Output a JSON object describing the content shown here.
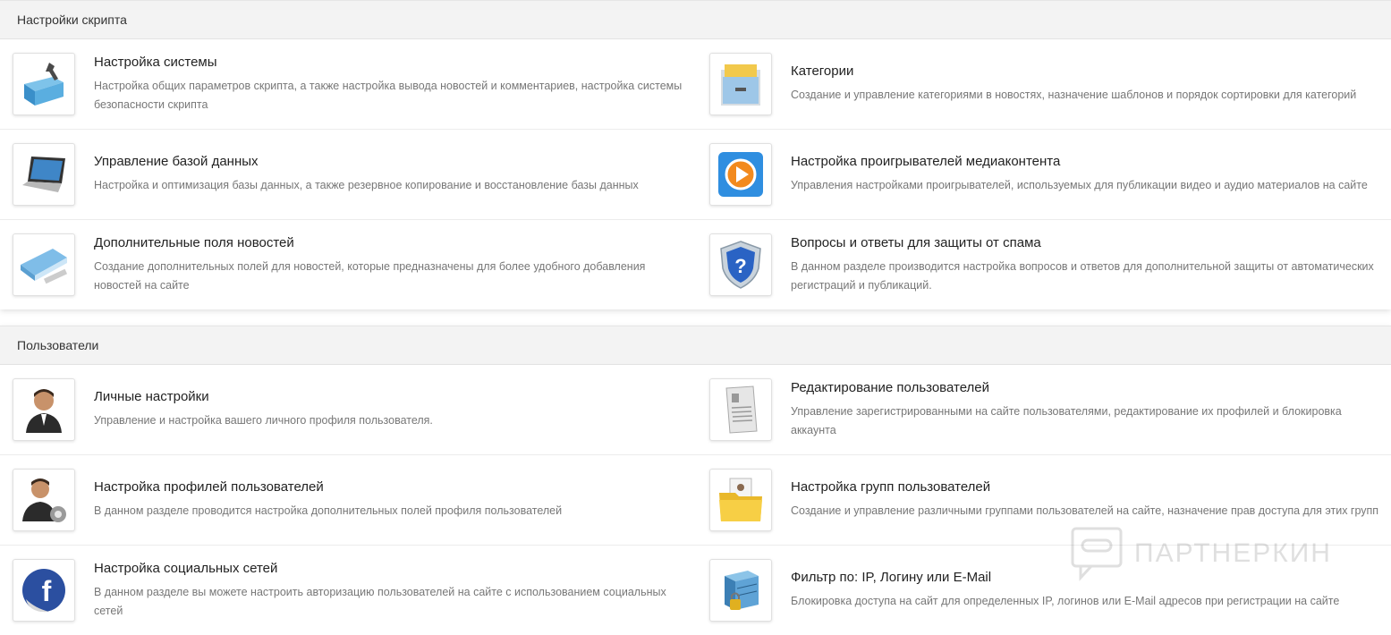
{
  "sections": [
    {
      "title": "Настройки скрипта",
      "rows": [
        [
          {
            "icon": "toolbox-icon",
            "title": "Настройка системы",
            "desc": "Настройка общих параметров скрипта, а также настройка вывода новостей и комментариев, настройка системы безопасности скрипта"
          },
          {
            "icon": "file-cabinet-icon",
            "title": "Категории",
            "desc": "Создание и управление категориями в новостях, назначение шаблонов и порядок сортировки для категорий"
          }
        ],
        [
          {
            "icon": "laptop-icon",
            "title": "Управление базой данных",
            "desc": "Настройка и оптимизация базы данных, а также резервное копирование и восстановление базы данных"
          },
          {
            "icon": "media-player-icon",
            "title": "Настройка проигрывателей медиаконтента",
            "desc": "Управления настройками проигрывателей, используемых для публикации видео и аудио материалов на сайте"
          }
        ],
        [
          {
            "icon": "ruler-icon",
            "title": "Дополнительные поля новостей",
            "desc": "Создание дополнительных полей для новостей, которые предназначены для более удобного добавления новостей на сайте"
          },
          {
            "icon": "shield-question-icon",
            "title": "Вопросы и ответы для защиты от спама",
            "desc": "В данном разделе производится настройка вопросов и ответов для дополнительной защиты от автоматических регистраций и публикаций."
          }
        ]
      ]
    },
    {
      "title": "Пользователи",
      "rows": [
        [
          {
            "icon": "user-icon",
            "title": "Личные настройки",
            "desc": "Управление и настройка вашего личного профиля пользователя."
          },
          {
            "icon": "document-icon",
            "title": "Редактирование пользователей",
            "desc": "Управление зарегистрированными на сайте пользователями, редактирование их профилей и блокировка аккаунта"
          }
        ],
        [
          {
            "icon": "user-gear-icon",
            "title": "Настройка профилей пользователей",
            "desc": "В данном разделе проводится настройка дополнительных полей профиля пользователей"
          },
          {
            "icon": "folder-users-icon",
            "title": "Настройка групп пользователей",
            "desc": "Создание и управление различными группами пользователей на сайте, назначение прав доступа для этих групп"
          }
        ],
        [
          {
            "icon": "facebook-icon",
            "title": "Настройка социальных сетей",
            "desc": "В данном разделе вы можете настроить авторизацию пользователей на сайте с использованием социальных сетей"
          },
          {
            "icon": "locked-server-icon",
            "title": "Фильтр по: IP, Логину или E-Mail",
            "desc": "Блокировка доступа на сайт для определенных IP, логинов или E-Mail адресов при регистрации на сайте"
          }
        ]
      ]
    }
  ],
  "watermark": {
    "text": "ПАРТНЕРКИН"
  }
}
